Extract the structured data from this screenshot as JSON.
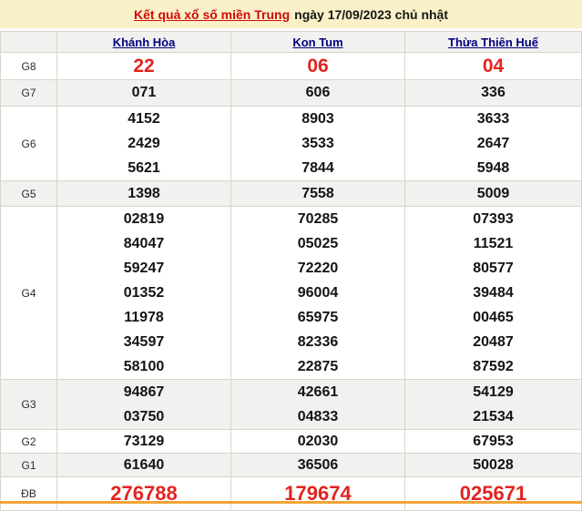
{
  "title": {
    "link_text": "Kết quả xổ số miền Trung",
    "rest_text": "ngày 17/09/2023 chủ nhật"
  },
  "colors": {
    "band_background": "#faf1c9",
    "title_link_red": "#d20a0a",
    "prize_highlight_red": "#e2241f",
    "column_link_navy": "#000080",
    "alt_row_gray": "#f1f1ef",
    "border": "#d9d5c9",
    "bottom_strip_orange": "#f0a438"
  },
  "table": {
    "columns": [
      "Khánh Hòa",
      "Kon Tum",
      "Thừa Thiên Huế"
    ],
    "rows": [
      {
        "label": "G8",
        "highlight": true,
        "values": [
          [
            "22"
          ],
          [
            "06"
          ],
          [
            "04"
          ]
        ]
      },
      {
        "label": "G7",
        "highlight": false,
        "values": [
          [
            "071"
          ],
          [
            "606"
          ],
          [
            "336"
          ]
        ]
      },
      {
        "label": "G6",
        "highlight": false,
        "values": [
          [
            "4152",
            "2429",
            "5621"
          ],
          [
            "8903",
            "3533",
            "7844"
          ],
          [
            "3633",
            "2647",
            "5948"
          ]
        ]
      },
      {
        "label": "G5",
        "highlight": false,
        "values": [
          [
            "1398"
          ],
          [
            "7558"
          ],
          [
            "5009"
          ]
        ]
      },
      {
        "label": "G4",
        "highlight": false,
        "values": [
          [
            "02819",
            "84047",
            "59247",
            "01352",
            "11978",
            "34597",
            "58100"
          ],
          [
            "70285",
            "05025",
            "72220",
            "96004",
            "65975",
            "82336",
            "22875"
          ],
          [
            "07393",
            "11521",
            "80577",
            "39484",
            "00465",
            "20487",
            "87592"
          ]
        ]
      },
      {
        "label": "G3",
        "highlight": false,
        "values": [
          [
            "94867",
            "03750"
          ],
          [
            "42661",
            "04833"
          ],
          [
            "54129",
            "21534"
          ]
        ]
      },
      {
        "label": "G2",
        "highlight": false,
        "values": [
          [
            "73129"
          ],
          [
            "02030"
          ],
          [
            "67953"
          ]
        ]
      },
      {
        "label": "G1",
        "highlight": false,
        "values": [
          [
            "61640"
          ],
          [
            "36506"
          ],
          [
            "50028"
          ]
        ]
      },
      {
        "label": "ĐB",
        "highlight": true,
        "values": [
          [
            "276788"
          ],
          [
            "179674"
          ],
          [
            "025671"
          ]
        ]
      }
    ]
  }
}
